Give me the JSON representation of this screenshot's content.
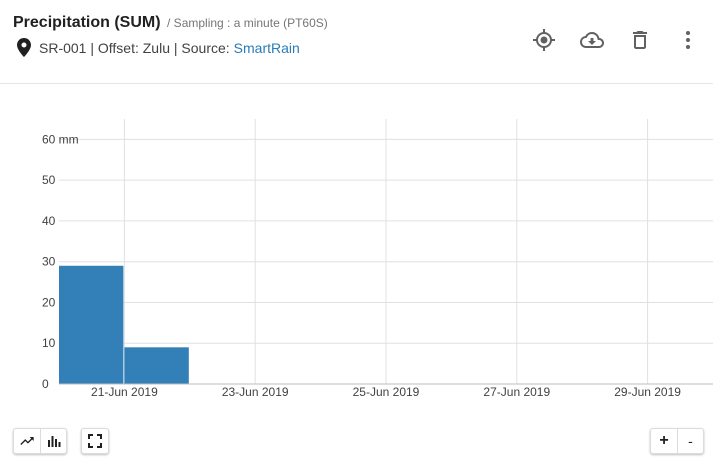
{
  "header": {
    "title": "Precipitation (SUM)",
    "subtitle": "/ Sampling : a minute (PT60S)",
    "meta_text": "SR-001 | Offset: Zulu | Source:",
    "source_link": "SmartRain",
    "icons": [
      "location-pin-icon",
      "target-icon",
      "cloud-download-icon",
      "trash-icon",
      "more-vert-icon"
    ]
  },
  "chart_data": {
    "type": "bar",
    "ylim": [
      0,
      65
    ],
    "yticks": [
      {
        "value": 0,
        "label": "0"
      },
      {
        "value": 10,
        "label": "10"
      },
      {
        "value": 20,
        "label": "20"
      },
      {
        "value": 30,
        "label": "30"
      },
      {
        "value": 40,
        "label": "40"
      },
      {
        "value": 50,
        "label": "50"
      },
      {
        "value": 60,
        "label": "60 mm"
      }
    ],
    "xlim": [
      "2019-06-20",
      "2019-06-30"
    ],
    "xticks": [
      {
        "date": "2019-06-21",
        "label": "21-Jun 2019"
      },
      {
        "date": "2019-06-23",
        "label": "23-Jun 2019"
      },
      {
        "date": "2019-06-25",
        "label": "25-Jun 2019"
      },
      {
        "date": "2019-06-27",
        "label": "27-Jun 2019"
      },
      {
        "date": "2019-06-29",
        "label": "29-Jun 2019"
      }
    ],
    "bars": [
      {
        "start": "2019-06-20",
        "end": "2019-06-21",
        "value": 29
      },
      {
        "start": "2019-06-21",
        "end": "2019-06-22",
        "value": 9
      }
    ],
    "bar_color": "#337fb8",
    "grid": true
  },
  "controls": {
    "line_icon": "trending-up-icon",
    "bar_icon": "bar-chart-icon",
    "fullscreen_icon": "fullscreen-icon",
    "zoom_in_label": "+",
    "zoom_out_label": "-"
  }
}
